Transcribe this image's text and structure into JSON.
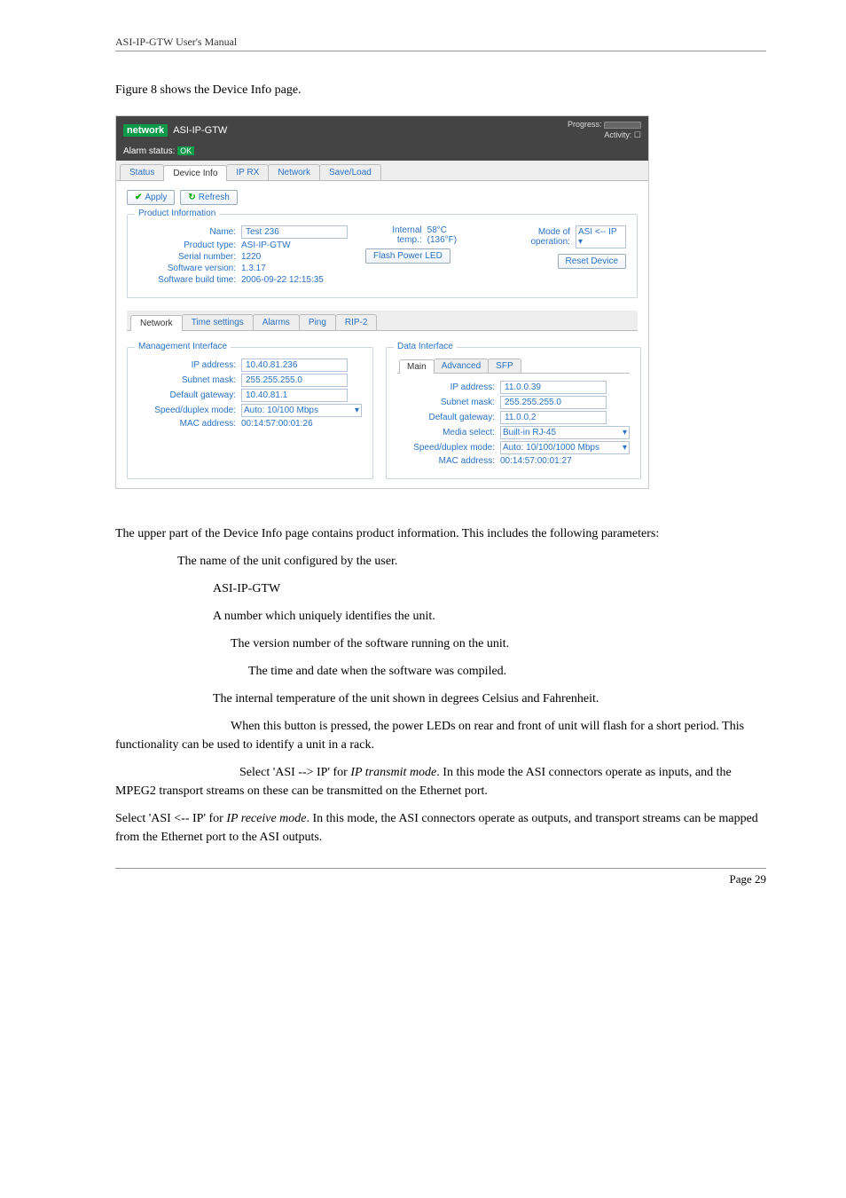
{
  "doc": {
    "header": "ASI-IP-GTW User's Manual",
    "fig_caption": "Figure 8 shows the Device Info page.",
    "para_intro_1": "The upper part of the Device Info page contains product information. This includes the following parameters:",
    "param_name": "The name of the unit configured by the user.",
    "param_type_prefix": "ASI-IP-GTW",
    "param_serial": "A number which uniquely identifies the unit.",
    "param_swver": "The version number of the software running on the unit.",
    "param_build": "The time and date when the software was compiled.",
    "param_temp": "The internal temperature of the unit shown in degrees Celsius and Fahrenheit.",
    "param_flash": "When this button is pressed, the power LEDs on rear and front of unit will flash for a short period. This functionality can be used to identify a unit in a rack.",
    "param_mode_a": "Select 'ASI --> IP' for ",
    "param_mode_a_em": "IP transmit mode",
    "param_mode_a_tail": ". In this mode the ASI connectors operate as inputs, and the MPEG2 transport streams on these can be transmitted on the Ethernet port.",
    "param_mode_b": "Select 'ASI <-- IP' for ",
    "param_mode_b_em": "IP receive mode",
    "param_mode_b_tail": ". In this mode, the ASI connectors operate as outputs, and transport streams can be mapped from the Ethernet port to the ASI outputs.",
    "footer_page": "Page 29"
  },
  "shot": {
    "logo_word": "network",
    "product_title": "ASI-IP-GTW",
    "progress_label": "Progress:",
    "activity_label": "Activity:",
    "alarm_status_label": "Alarm status:",
    "alarm_status_value": "OK",
    "tabs": {
      "status": "Status",
      "device": "Device Info",
      "iprx": "IP RX",
      "network": "Network",
      "save": "Save/Load"
    },
    "apply_label": "Apply",
    "refresh_label": "Refresh",
    "pi_legend": "Product Information",
    "name_label": "Name:",
    "name_value": "Test 236",
    "ptype_label": "Product type:",
    "ptype_value": "ASI-IP-GTW",
    "serial_label": "Serial number:",
    "serial_value": "1220",
    "swver_label": "Software version:",
    "swver_value": "1.3.17",
    "build_label": "Software build time:",
    "build_value": "2006-09-22 12:15:35",
    "temp_label": "Internal temp.:",
    "temp_value": "58°C (136°F)",
    "flash_btn": "Flash Power LED",
    "mode_label": "Mode of operation:",
    "mode_value": "ASI <-- IP",
    "reset_btn": "Reset Device",
    "subtabs": {
      "network": "Network",
      "time": "Time settings",
      "alarms": "Alarms",
      "ping": "Ping",
      "rip": "RIP-2"
    },
    "mgmt_legend": "Management Interface",
    "data_legend": "Data Interface",
    "data_tabs": {
      "main": "Main",
      "adv": "Advanced",
      "sfp": "SFP"
    },
    "ip_label": "IP address:",
    "mask_label": "Subnet mask:",
    "gw_label": "Default gateway:",
    "speed_label": "Speed/duplex mode:",
    "mac_label": "MAC address:",
    "media_label": "Media select:",
    "mgmt": {
      "ip": "10.40.81.236",
      "mask": "255.255.255.0",
      "gw": "10.40.81.1",
      "speed": "Auto: 10/100 Mbps",
      "mac": "00:14:57:00:01:26"
    },
    "data": {
      "ip": "11.0.0.39",
      "mask": "255.255.255.0",
      "gw": "11.0.0.2",
      "media": "Built-in RJ-45",
      "speed": "Auto: 10/100/1000 Mbps",
      "mac": "00:14:57:00:01:27"
    }
  }
}
